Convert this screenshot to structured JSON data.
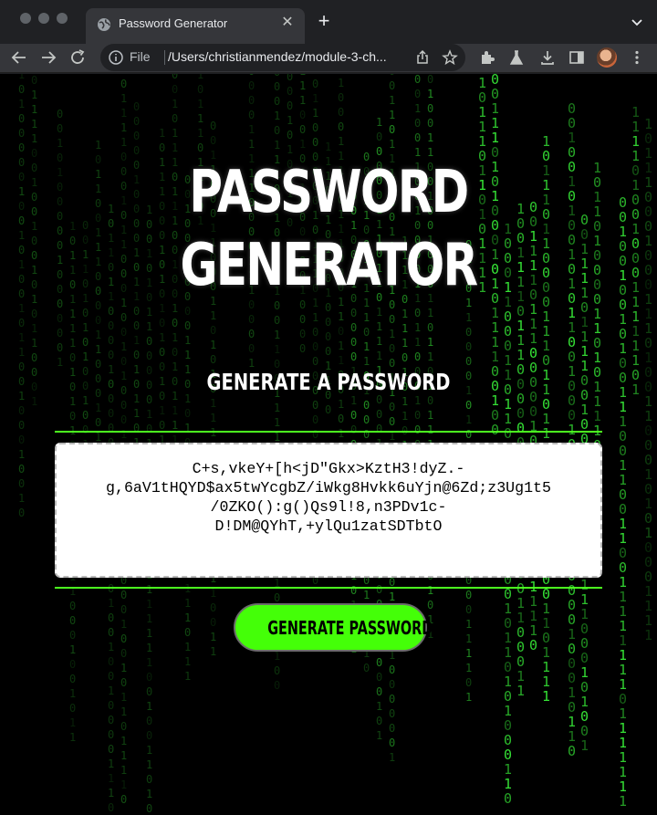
{
  "browser": {
    "tab": {
      "title": "Password Generator"
    },
    "address_bar": {
      "scheme": "File",
      "url": "/Users/christianmendez/module-3-ch..."
    }
  },
  "page": {
    "title": "PASSWORD GENERATOR",
    "subtitle": "GENERATE A PASSWORD",
    "password": "C+s,vkeY+[h<jD\"Gkx>KztH3!dyZ.-g,6aV1tHQYD$ax5twYcgbZ/iWkg8Hvkk6uYjn@6Zd;z3Ug1t5/0ZKO():g()Qs9l!8,n3PDv1c-D!DM@QYhT,+ylQu1zatSDTbtO",
    "password_lines": [
      "C+s,vkeY+[h<jD\"Gkx>KztH3!dyZ.-",
      "g,6aV1tHQYD$ax5twYcgbZ/iWkg8Hvkk6uYjn@6Zd;z3Ug1t5",
      "/0ZKO():g()Qs9l!8,n3PDv1c-",
      "D!DM@QYhT,+ylQu1zatSDTbtO"
    ],
    "button_label": "GENERATE PASSWORD"
  },
  "colors": {
    "accent": "#44ff08",
    "rule": "#4cff1f",
    "background": "#000000"
  }
}
